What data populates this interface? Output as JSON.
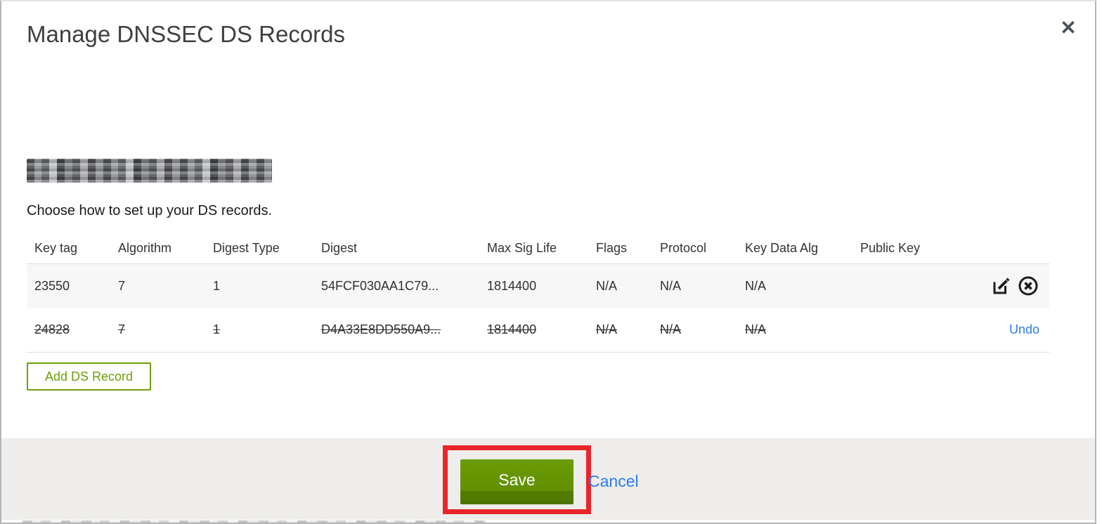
{
  "dialog": {
    "title": "Manage DNSSEC DS Records",
    "intro": "Choose how to set up your DS records.",
    "add_ds_record_label": "Add DS Record"
  },
  "icons": {
    "close_glyph": "✕",
    "edit": "edit-pencil-square",
    "delete": "circle-x"
  },
  "table": {
    "headers": [
      "Key tag",
      "Algorithm",
      "Digest Type",
      "Digest",
      "Max Sig Life",
      "Flags",
      "Protocol",
      "Key Data Alg",
      "Public Key"
    ],
    "rows": [
      {
        "key_tag": "23550",
        "algorithm": "7",
        "digest_type": "1",
        "digest": "54FCF030AA1C79...",
        "max_sig_life": "1814400",
        "flags": "N/A",
        "protocol": "N/A",
        "key_data_alg": "N/A",
        "public_key": "",
        "state": "active"
      },
      {
        "key_tag": "24828",
        "algorithm": "7",
        "digest_type": "1",
        "digest": "D4A33E8DD550A9...",
        "max_sig_life": "1814400",
        "flags": "N/A",
        "protocol": "N/A",
        "key_data_alg": "N/A",
        "public_key": "",
        "state": "deleted",
        "undo_label": "Undo"
      }
    ]
  },
  "footer": {
    "save_label": "Save",
    "cancel_label": "Cancel"
  },
  "colors": {
    "green": "#6ca006",
    "green_dark": "#4e7500",
    "link_blue": "#2e7cf0",
    "annotation_red": "#e8252a",
    "footer_bg": "#eeedec",
    "row_highlight_bg": "#f7f7f7"
  }
}
